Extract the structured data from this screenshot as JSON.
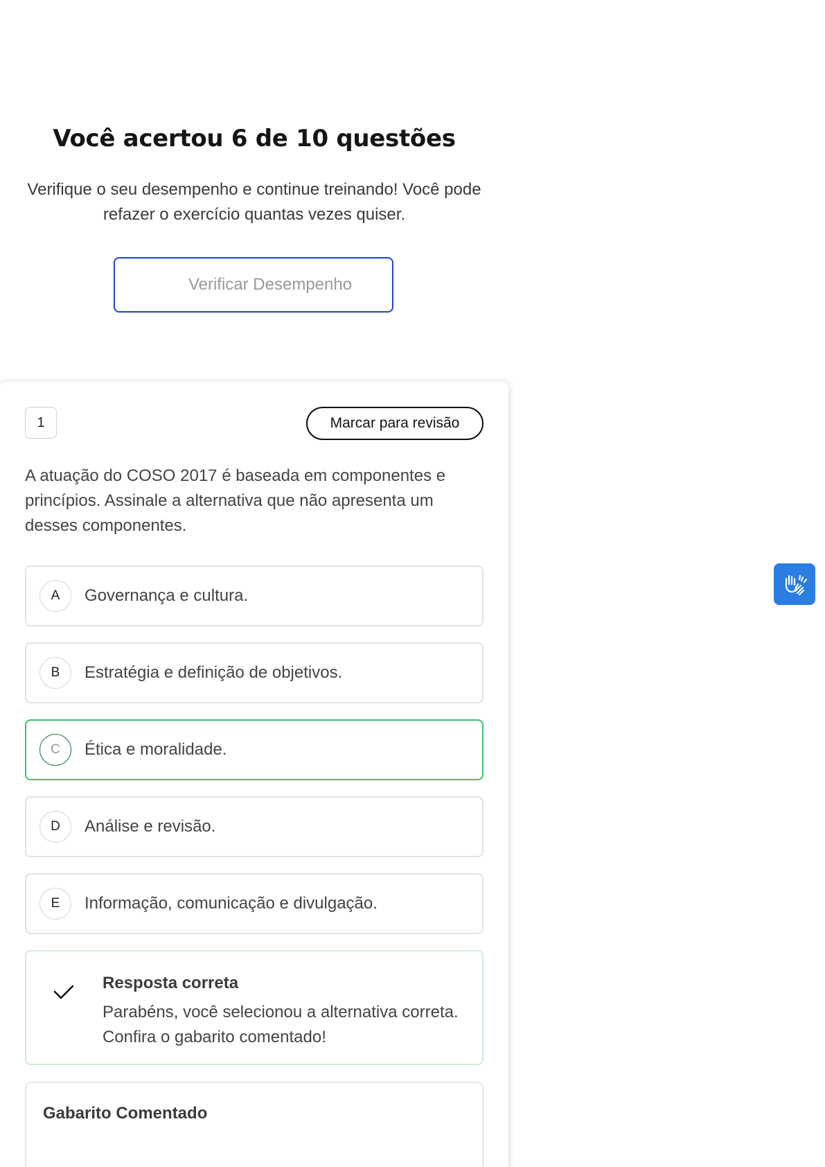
{
  "result": {
    "title": "Você acertou 6 de 10 questões",
    "subtitle": "Verifique o seu desempenho e continue treinando! Você pode refazer o exercício quantas vezes quiser.",
    "verify_button_label": "Verificar Desempenho"
  },
  "question": {
    "number": "1",
    "review_button_label": "Marcar para revisão",
    "text": "A atuação do COSO 2017 é baseada em componentes e princípios. Assinale a alternativa que não apresenta um desses componentes.",
    "options": [
      {
        "letter": "A",
        "text": "Governança e cultura."
      },
      {
        "letter": "B",
        "text": "Estratégia e definição de objetivos."
      },
      {
        "letter": "C",
        "text": "Ética e moralidade."
      },
      {
        "letter": "D",
        "text": "Análise e revisão."
      },
      {
        "letter": "E",
        "text": "Informação, comunicação e divulgação."
      }
    ],
    "correct_option": "C"
  },
  "feedback": {
    "icon": "check-icon",
    "title": "Resposta correta",
    "text": "Parabéns, você selecionou a alternativa correta. Confira o gabarito comentado!"
  },
  "answer_key": {
    "title": "Gabarito Comentado"
  },
  "accessibility": {
    "icon": "sign-language-hands-icon"
  },
  "colors": {
    "primary_blue": "#1f48c4",
    "correct_green": "#3cc467",
    "accessibility_blue": "#2a7de1"
  }
}
